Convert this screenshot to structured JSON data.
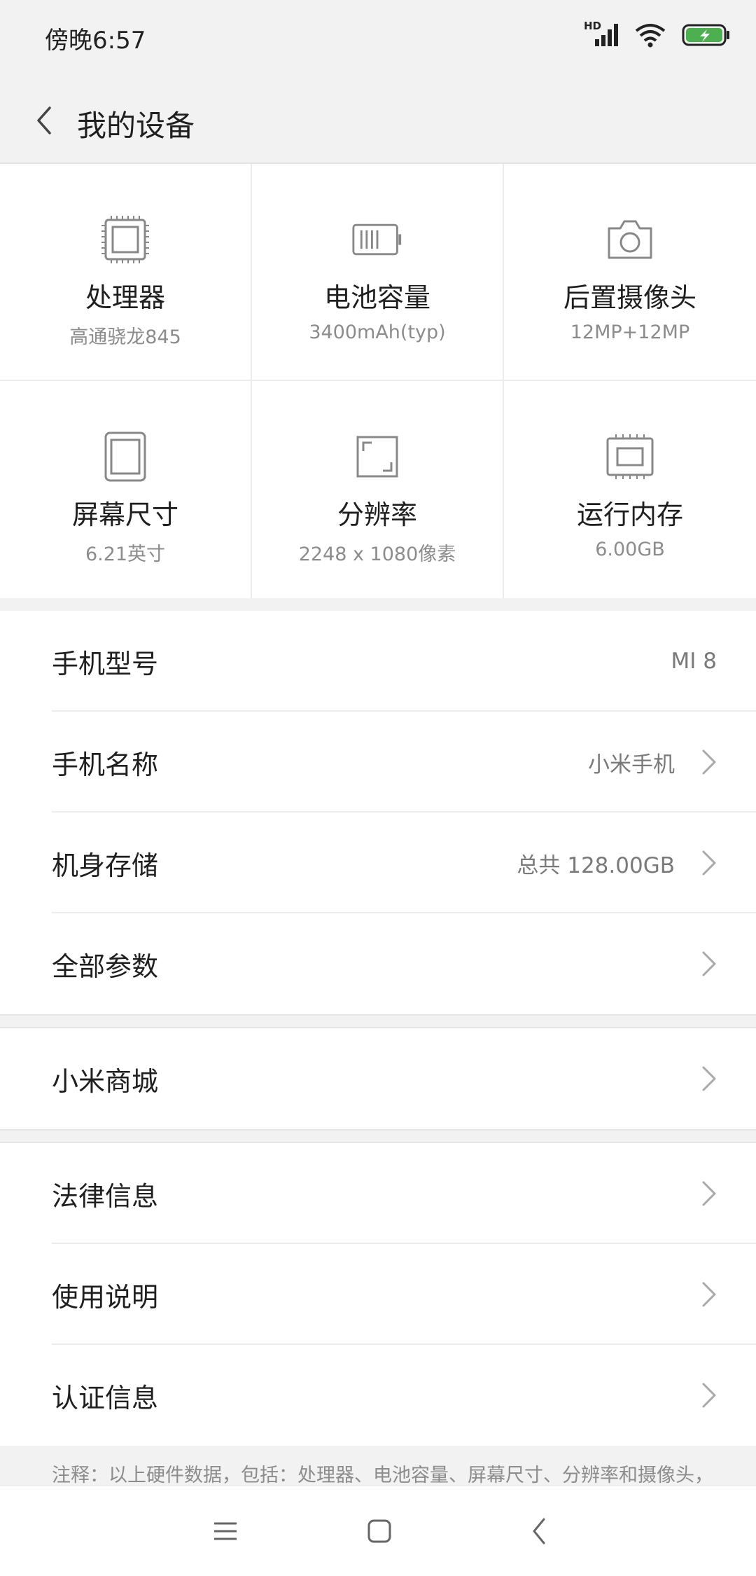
{
  "status_bar": {
    "time": "傍晚6:57",
    "network_badge": "HD",
    "icons": [
      "signal-icon",
      "wifi-icon",
      "battery-charging-icon"
    ],
    "battery_color": "#4caf50"
  },
  "header": {
    "title": "我的设备",
    "back_icon": "back-chevron-icon"
  },
  "specs": [
    {
      "label": "处理器",
      "value": "高通骁龙845",
      "icon": "processor-icon"
    },
    {
      "label": "电池容量",
      "value": "3400mAh(typ)",
      "icon": "battery-icon"
    },
    {
      "label": "后置摄像头",
      "value": "12MP+12MP",
      "icon": "camera-icon"
    },
    {
      "label": "屏幕尺寸",
      "value": "6.21英寸",
      "icon": "screen-size-icon"
    },
    {
      "label": "分辨率",
      "value": "2248 x 1080像素",
      "icon": "resolution-icon"
    },
    {
      "label": "运行内存",
      "value": "6.00GB",
      "icon": "memory-icon"
    }
  ],
  "device_list": [
    {
      "label": "手机型号",
      "value": "MI 8"
    },
    {
      "label": "手机名称",
      "value": "小米手机"
    },
    {
      "label": "机身存储",
      "value": "总共 128.00GB"
    },
    {
      "label": "全部参数",
      "value": ""
    }
  ],
  "store_list": [
    {
      "label": "小米商城"
    }
  ],
  "info_list": [
    {
      "label": "法律信息"
    },
    {
      "label": "使用说明"
    },
    {
      "label": "认证信息"
    }
  ],
  "note": "注释：以上硬件数据，包括：处理器、电池容量、屏幕尺寸、分辨率和摄像头，",
  "nav_bar": {
    "icons": [
      "menu-icon",
      "home-icon",
      "back-icon"
    ]
  }
}
